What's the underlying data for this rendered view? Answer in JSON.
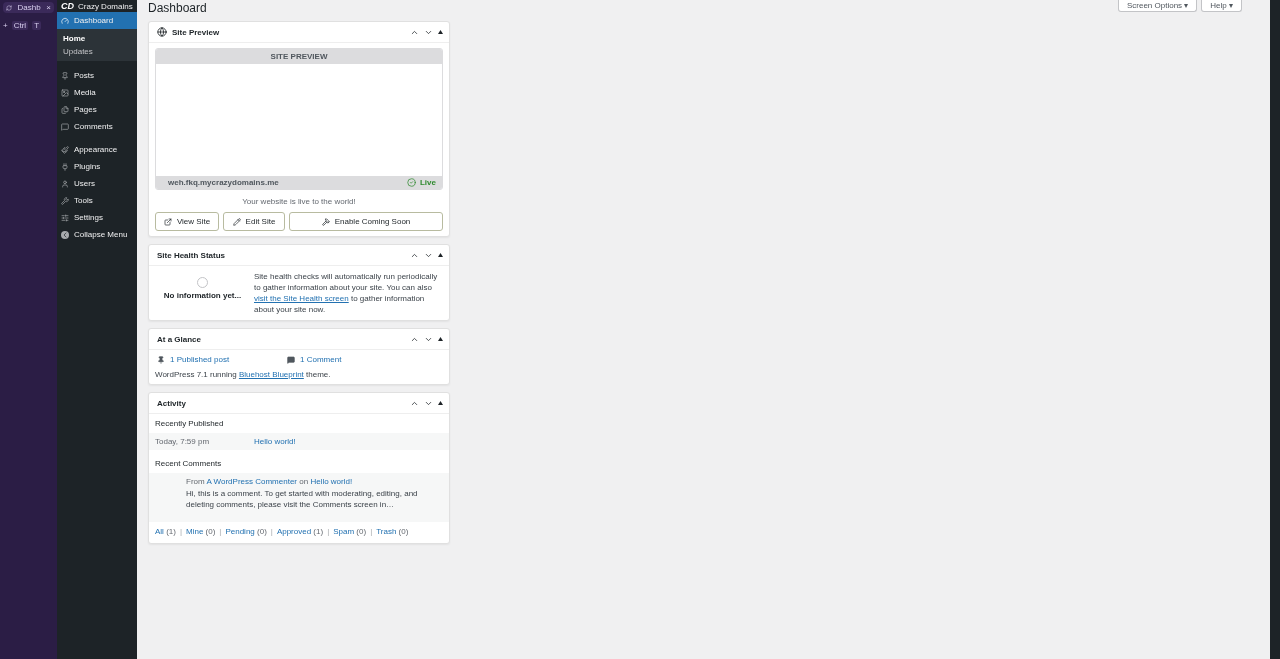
{
  "browser": {
    "tab_title": "Dashb",
    "tab_close": "×",
    "new_tab": "+",
    "shortcut": [
      "Ctrl",
      "T"
    ]
  },
  "sidebar": {
    "logo": "CD",
    "brand": "Crazy Domains",
    "groups": [
      [
        {
          "label": "Dashboard",
          "selected": true,
          "children": [
            {
              "label": "Home",
              "selected": true
            },
            {
              "label": "Updates",
              "selected": false
            }
          ]
        }
      ],
      [
        {
          "label": "Posts",
          "selected": false
        },
        {
          "label": "Media",
          "selected": false
        },
        {
          "label": "Pages",
          "selected": false
        },
        {
          "label": "Comments",
          "selected": false
        }
      ],
      [
        {
          "label": "Appearance",
          "selected": false
        },
        {
          "label": "Plugins",
          "selected": false
        },
        {
          "label": "Users",
          "selected": false
        },
        {
          "label": "Tools",
          "selected": false
        },
        {
          "label": "Settings",
          "selected": false
        }
      ]
    ],
    "collapse": "Collapse Menu"
  },
  "page_title": "Dashboard",
  "top_buttons": [
    "Screen Options ▾",
    "Help ▾"
  ],
  "site_preview": {
    "title": "Site Preview",
    "header": "SITE PREVIEW",
    "url": "weh.fkq.mycrazydomains.me",
    "status": "Live",
    "message": "Your website is live to the world!",
    "buttons": [
      "View Site",
      "Edit Site",
      "Enable Coming Soon"
    ]
  },
  "site_health": {
    "title": "Site Health Status",
    "status": "No information yet...",
    "text_before": "Site health checks will automatically run periodically to gather information about your site. You can also ",
    "link": "visit the Site Health screen",
    "text_after": " to gather information about your site now."
  },
  "at_a_glance": {
    "title": "At a Glance",
    "items": [
      "1 Published post",
      "1 Comment"
    ],
    "text_before": "WordPress 7.1 running ",
    "link": "Bluehost Blueprint",
    "text_after": " theme."
  },
  "activity": {
    "title": "Activity",
    "recently_published": "Recently Published",
    "posts": [
      {
        "date": "Today, 7:59 pm",
        "title": "Hello world!"
      }
    ],
    "recent_comments": "Recent Comments",
    "comments": [
      {
        "from": "From",
        "author": "A WordPress Commenter",
        "on": "on",
        "post": "Hello world!",
        "text": "Hi, this is a comment. To get started with moderating, editing, and deleting comments, please visit the Comments screen in…"
      }
    ],
    "filters": [
      {
        "label": "All",
        "count": "(1)"
      },
      {
        "label": "Mine",
        "count": "(0)"
      },
      {
        "label": "Pending",
        "count": "(0)"
      },
      {
        "label": "Approved",
        "count": "(1)"
      },
      {
        "label": "Spam",
        "count": "(0)"
      },
      {
        "label": "Trash",
        "count": "(0)"
      }
    ],
    "separator": "|"
  }
}
